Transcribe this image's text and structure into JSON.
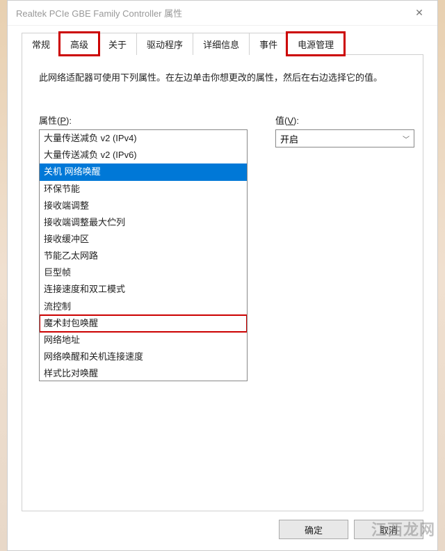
{
  "titlebar": {
    "title": "Realtek PCIe GBE Family Controller 属性",
    "close": "✕"
  },
  "tabs": [
    {
      "label": "常规",
      "active": false,
      "highlight": false
    },
    {
      "label": "高级",
      "active": true,
      "highlight": true
    },
    {
      "label": "关于",
      "active": false,
      "highlight": false
    },
    {
      "label": "驱动程序",
      "active": false,
      "highlight": false
    },
    {
      "label": "详细信息",
      "active": false,
      "highlight": false
    },
    {
      "label": "事件",
      "active": false,
      "highlight": false
    },
    {
      "label": "电源管理",
      "active": false,
      "highlight": true
    }
  ],
  "panel": {
    "description": "此网络适配器可使用下列属性。在左边单击你想更改的属性，然后在右边选择它的值。",
    "property_label_prefix": "属性(",
    "property_label_key": "P",
    "property_label_suffix": "):",
    "value_label_prefix": "值(",
    "value_label_key": "V",
    "value_label_suffix": "):",
    "value_selected": "开启",
    "properties": [
      {
        "label": "大量传送减负 v2 (IPv4)",
        "selected": false,
        "highlight": false
      },
      {
        "label": "大量传送减负 v2 (IPv6)",
        "selected": false,
        "highlight": false
      },
      {
        "label": "关机 网络唤醒",
        "selected": true,
        "highlight": false
      },
      {
        "label": "环保节能",
        "selected": false,
        "highlight": false
      },
      {
        "label": "接收端调整",
        "selected": false,
        "highlight": false
      },
      {
        "label": "接收端调整最大伫列",
        "selected": false,
        "highlight": false
      },
      {
        "label": "接收缓冲区",
        "selected": false,
        "highlight": false
      },
      {
        "label": "节能乙太网路",
        "selected": false,
        "highlight": false
      },
      {
        "label": "巨型帧",
        "selected": false,
        "highlight": false
      },
      {
        "label": "连接速度和双工模式",
        "selected": false,
        "highlight": false
      },
      {
        "label": "流控制",
        "selected": false,
        "highlight": false
      },
      {
        "label": "魔术封包唤醒",
        "selected": false,
        "highlight": true
      },
      {
        "label": "网络地址",
        "selected": false,
        "highlight": false
      },
      {
        "label": "网络唤醒和关机连接速度",
        "selected": false,
        "highlight": false
      },
      {
        "label": "样式比对唤醒",
        "selected": false,
        "highlight": false
      }
    ]
  },
  "buttons": {
    "ok": "确定",
    "cancel": "取消"
  },
  "watermark": "江西龙网"
}
